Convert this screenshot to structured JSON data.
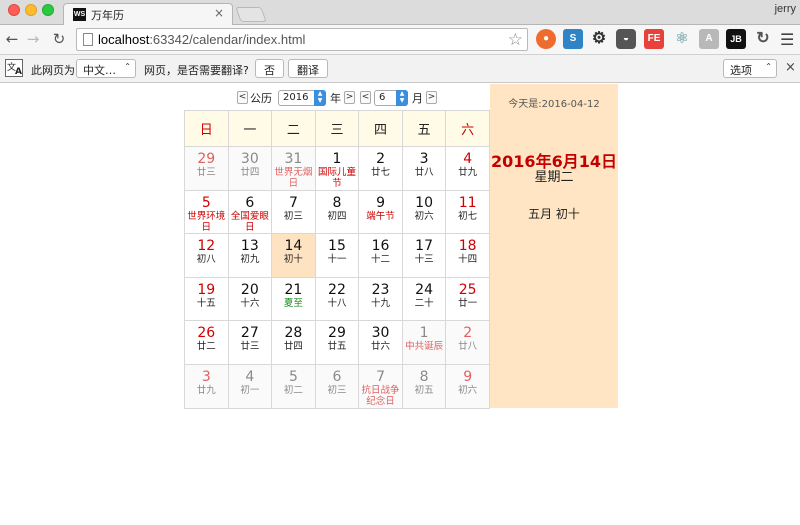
{
  "browser": {
    "tab_title": "万年历",
    "tab_favicon": "WS",
    "tab_close": "×",
    "profile": "jerry",
    "url_host": "localhost",
    "url_rest": ":63342/calendar/index.html",
    "extensions": [
      {
        "icon": "ublock-icon",
        "label": "●"
      },
      {
        "icon": "s-ext-icon",
        "label": "S"
      },
      {
        "icon": "gear-icon",
        "label": "⚙"
      },
      {
        "icon": "pocket-icon",
        "label": "◒"
      },
      {
        "icon": "fe-icon",
        "label": "FE"
      },
      {
        "icon": "react-icon",
        "label": "⚛"
      },
      {
        "icon": "angular-icon",
        "label": "A"
      },
      {
        "icon": "jb-icon",
        "label": "JB"
      },
      {
        "icon": "sync-icon",
        "label": "↻"
      }
    ]
  },
  "translate": {
    "icon_a": "文",
    "icon_b": "A",
    "prefix": "此网页为",
    "language": "中文…",
    "question": "网页，是否需要翻译?",
    "no_button": "否",
    "translate_button": "翻译",
    "options": "选项",
    "close": "×"
  },
  "calendar": {
    "prev_year": "<",
    "gongli": "公历",
    "year_value": "2016",
    "year_unit": "年",
    "next_year": ">",
    "prev_month": "<",
    "month_value": "6",
    "month_unit": "月",
    "next_month": ">",
    "weekdays": [
      "日",
      "一",
      "二",
      "三",
      "四",
      "五",
      "六"
    ],
    "weeks": [
      [
        {
          "d": "29",
          "l": "廿三",
          "other": true
        },
        {
          "d": "30",
          "l": "廿四",
          "other": true
        },
        {
          "d": "31",
          "l": "世界无烟日",
          "other": true,
          "fest": true
        },
        {
          "d": "1",
          "l": "国际儿童节",
          "fest": true
        },
        {
          "d": "2",
          "l": "廿七"
        },
        {
          "d": "3",
          "l": "廿八"
        },
        {
          "d": "4",
          "l": "廿九"
        }
      ],
      [
        {
          "d": "5",
          "l": "世界环境日",
          "fest": true
        },
        {
          "d": "6",
          "l": "全国爱眼日",
          "fest": true
        },
        {
          "d": "7",
          "l": "初三"
        },
        {
          "d": "8",
          "l": "初四"
        },
        {
          "d": "9",
          "l": "端午节",
          "fest": true
        },
        {
          "d": "10",
          "l": "初六"
        },
        {
          "d": "11",
          "l": "初七"
        }
      ],
      [
        {
          "d": "12",
          "l": "初八"
        },
        {
          "d": "13",
          "l": "初九"
        },
        {
          "d": "14",
          "l": "初十",
          "today": true
        },
        {
          "d": "15",
          "l": "十一"
        },
        {
          "d": "16",
          "l": "十二"
        },
        {
          "d": "17",
          "l": "十三"
        },
        {
          "d": "18",
          "l": "十四"
        }
      ],
      [
        {
          "d": "19",
          "l": "十五"
        },
        {
          "d": "20",
          "l": "十六"
        },
        {
          "d": "21",
          "l": "夏至",
          "term": true
        },
        {
          "d": "22",
          "l": "十八"
        },
        {
          "d": "23",
          "l": "十九"
        },
        {
          "d": "24",
          "l": "二十"
        },
        {
          "d": "25",
          "l": "廿一"
        }
      ],
      [
        {
          "d": "26",
          "l": "廿二"
        },
        {
          "d": "27",
          "l": "廿三"
        },
        {
          "d": "28",
          "l": "廿四"
        },
        {
          "d": "29",
          "l": "廿五"
        },
        {
          "d": "30",
          "l": "廿六"
        },
        {
          "d": "1",
          "l": "中共诞辰",
          "other": true,
          "fest": true
        },
        {
          "d": "2",
          "l": "廿八",
          "other": true
        }
      ],
      [
        {
          "d": "3",
          "l": "廿九",
          "other": true
        },
        {
          "d": "4",
          "l": "初一",
          "other": true
        },
        {
          "d": "5",
          "l": "初二",
          "other": true
        },
        {
          "d": "6",
          "l": "初三",
          "other": true
        },
        {
          "d": "7",
          "l": "抗日战争纪念日",
          "other": true,
          "fest": true
        },
        {
          "d": "8",
          "l": "初五",
          "other": true
        },
        {
          "d": "9",
          "l": "初六",
          "other": true
        }
      ]
    ],
    "side": {
      "today_label": "今天是:2016-04-12",
      "big_date": "2016年6月14日",
      "weekday": "星期二",
      "lunar": "五月 初十"
    }
  }
}
